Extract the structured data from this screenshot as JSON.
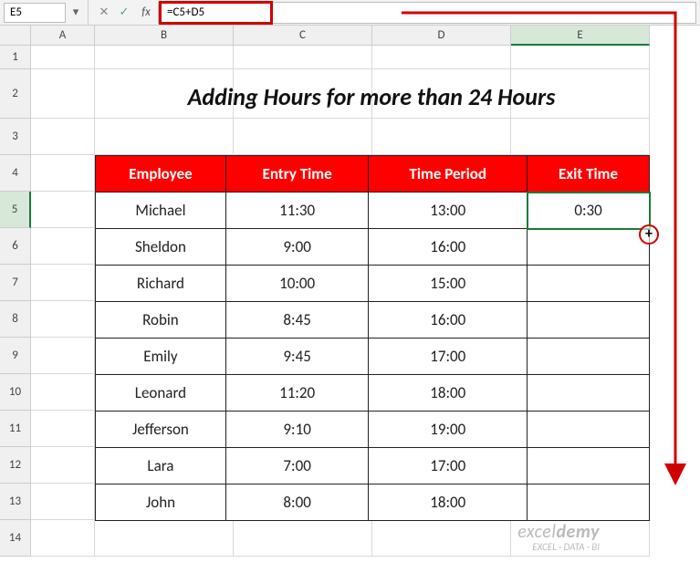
{
  "formula_bar": {
    "cell_ref": "E5",
    "fx_label": "fx",
    "formula": "=C5+D5"
  },
  "columns": [
    "A",
    "B",
    "C",
    "D",
    "E"
  ],
  "selected_col": "E",
  "selected_row": "5",
  "rows": [
    "1",
    "2",
    "3",
    "4",
    "5",
    "6",
    "7",
    "8",
    "9",
    "10",
    "11",
    "12",
    "13",
    "14"
  ],
  "title": "Adding Hours for more than 24 Hours",
  "headers": {
    "employee": "Employee",
    "entry": "Entry Time",
    "period": "Time Period",
    "exit": "Exit Time"
  },
  "data": [
    {
      "employee": "Michael",
      "entry": "11:30",
      "period": "13:00",
      "exit": "0:30"
    },
    {
      "employee": "Sheldon",
      "entry": "9:00",
      "period": "16:00",
      "exit": ""
    },
    {
      "employee": "Richard",
      "entry": "10:00",
      "period": "15:00",
      "exit": ""
    },
    {
      "employee": "Robin",
      "entry": "8:45",
      "period": "16:00",
      "exit": ""
    },
    {
      "employee": "Emily",
      "entry": "9:45",
      "period": "17:00",
      "exit": ""
    },
    {
      "employee": "Leonard",
      "entry": "11:20",
      "period": "18:00",
      "exit": ""
    },
    {
      "employee": "Jefferson",
      "entry": "9:10",
      "period": "19:00",
      "exit": ""
    },
    {
      "employee": "Lara",
      "entry": "7:00",
      "period": "17:00",
      "exit": ""
    },
    {
      "employee": "John",
      "entry": "8:00",
      "period": "18:00",
      "exit": ""
    }
  ],
  "fill_handle_cursor": "+",
  "watermark": {
    "brand_left": "excel",
    "brand_right": "demy",
    "tagline": "EXCEL · DATA · BI"
  },
  "chart_data": {
    "type": "table",
    "title": "Adding Hours for more than 24 Hours",
    "columns": [
      "Employee",
      "Entry Time",
      "Time Period",
      "Exit Time"
    ],
    "rows": [
      [
        "Michael",
        "11:30",
        "13:00",
        "0:30"
      ],
      [
        "Sheldon",
        "9:00",
        "16:00",
        ""
      ],
      [
        "Richard",
        "10:00",
        "15:00",
        ""
      ],
      [
        "Robin",
        "8:45",
        "16:00",
        ""
      ],
      [
        "Emily",
        "9:45",
        "17:00",
        ""
      ],
      [
        "Leonard",
        "11:20",
        "18:00",
        ""
      ],
      [
        "Jefferson",
        "9:10",
        "19:00",
        ""
      ],
      [
        "Lara",
        "7:00",
        "17:00",
        ""
      ],
      [
        "John",
        "8:00",
        "18:00",
        ""
      ]
    ],
    "formula_cell": {
      "ref": "E5",
      "formula": "=C5+D5",
      "result": "0:30"
    }
  }
}
